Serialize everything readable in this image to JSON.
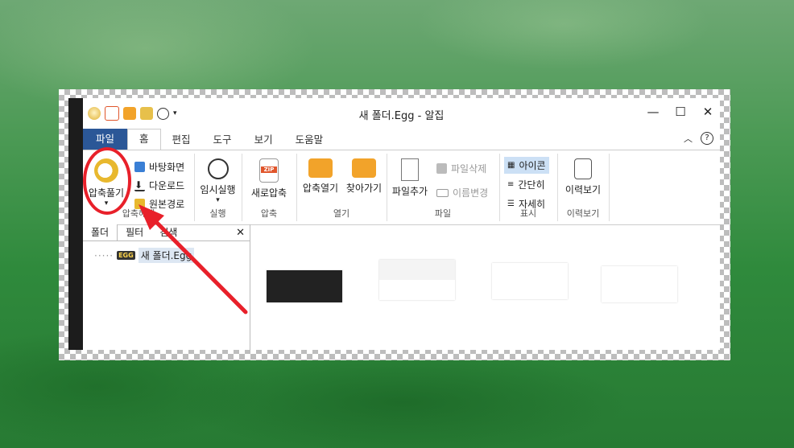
{
  "window": {
    "title": "새 폴더.Egg - 알집",
    "controls": {
      "minimize": "—",
      "maximize": "☐",
      "close": "✕"
    }
  },
  "tabs": [
    "파일",
    "홈",
    "편집",
    "도구",
    "보기",
    "도움말"
  ],
  "ribbon": {
    "extract": {
      "label": "압축풀기",
      "dropdown": "▾",
      "group": "압축해제",
      "items": [
        "바탕화면",
        "다운로드",
        "원본경로"
      ]
    },
    "run": {
      "label": "임시실행",
      "dropdown": "▾",
      "group": "실행"
    },
    "compress": {
      "label": "새로압축",
      "group": "압축",
      "zip": "ZIP"
    },
    "open": {
      "open_label": "압축열기",
      "find_label": "찾아가기",
      "group": "열기"
    },
    "file": {
      "add_label": "파일추가",
      "delete_label": "파일삭제",
      "rename_label": "이름변경",
      "group": "파일"
    },
    "view": {
      "icon_label": "아이콘",
      "simple_label": "간단히",
      "detail_label": "자세히",
      "group": "표시"
    },
    "history": {
      "label": "이력보기",
      "group": "이력보기"
    }
  },
  "panel": {
    "tabs": [
      "폴더",
      "필터",
      "검색"
    ],
    "close": "✕",
    "tree_item": "새 폴더.Egg",
    "egg_badge": "EGG"
  },
  "colors": {
    "file_tab": "#2b5797",
    "annotation": "#e8202a"
  }
}
